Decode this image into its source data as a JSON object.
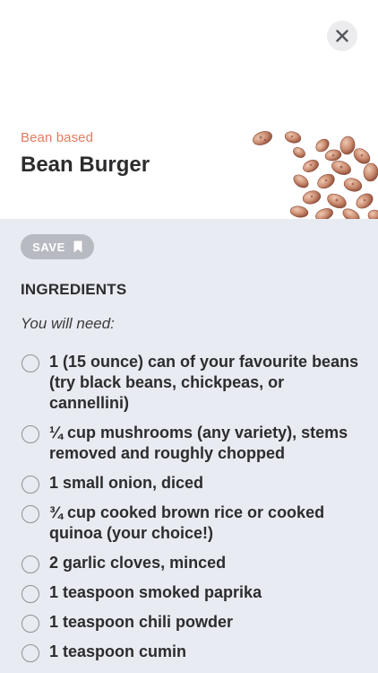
{
  "header": {
    "close_icon": "close-icon",
    "category": "Bean based",
    "title": "Bean Burger",
    "image": "beans-illustration"
  },
  "actions": {
    "save_label": "SAVE",
    "save_icon": "bookmark-icon"
  },
  "ingredients": {
    "heading": "INGREDIENTS",
    "intro": "You will need:",
    "items": [
      "1 (15 ounce) can of your favourite beans (try black beans, chickpeas, or cannellini)",
      "¼ cup mushrooms (any variety), stems removed and roughly chopped",
      "1 small onion, diced",
      "¾ cup cooked brown rice or cooked quinoa (your choice!)",
      "2 garlic cloves, minced",
      "1 teaspoon smoked paprika",
      "1 teaspoon chili powder",
      "1 teaspoon cumin"
    ]
  },
  "colors": {
    "accent": "#e57b5f",
    "panel_bg": "#e8ebf1",
    "save_bg": "#b7bac0"
  }
}
